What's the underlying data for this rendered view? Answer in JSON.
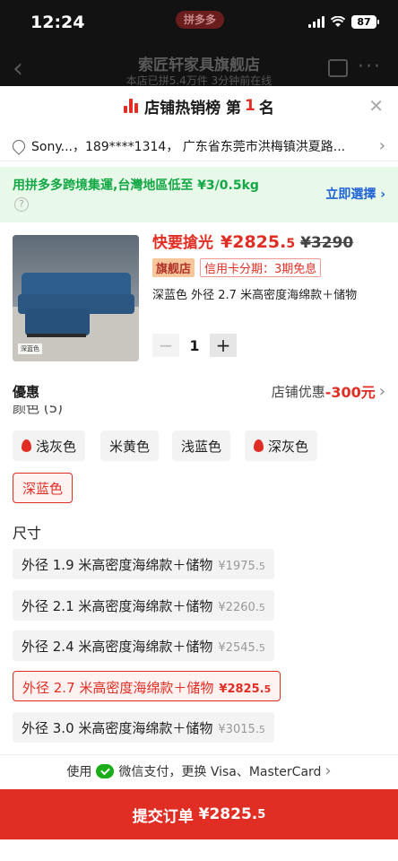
{
  "status": {
    "time": "12:24",
    "battery": "87",
    "app_badge": "拼多多"
  },
  "store": {
    "name": "索匠轩家具旗舰店",
    "subtitle": "本店已拼5.4万件  3分钟前在线"
  },
  "rank": {
    "prefix": "店铺热销榜 第",
    "number": "1",
    "suffix": "名"
  },
  "address": {
    "text": "Sony...，189****1314，  广东省东莞市洪梅镇洪夏路..."
  },
  "promo": {
    "text": "用拼多多跨境集運,台灣地區低至 ¥3/0.5kg",
    "button": "立即選擇"
  },
  "product": {
    "flash_label": "快要搶光",
    "price_main": "¥2825.",
    "price_dec": "5",
    "price_old": "¥3290",
    "tag_store": "旗舰店",
    "tag_credit": "信用卡分期：3期免息",
    "spec": "深蓝色 外径 2.7 米高密度海绵款＋储物",
    "image_label": "深蓝色",
    "quantity": "1",
    "minus": "−",
    "plus": "+"
  },
  "discount": {
    "label": "優惠",
    "text": "店铺优惠",
    "amount": "-300元"
  },
  "colors": {
    "heading": "颜色 (5)",
    "options": [
      {
        "label": "浅灰色",
        "hot": true,
        "selected": false
      },
      {
        "label": "米黄色",
        "hot": false,
        "selected": false
      },
      {
        "label": "浅蓝色",
        "hot": false,
        "selected": false
      },
      {
        "label": "深灰色",
        "hot": true,
        "selected": false
      },
      {
        "label": "深蓝色",
        "hot": false,
        "selected": true
      }
    ]
  },
  "sizes": {
    "heading": "尺寸",
    "options": [
      {
        "label": "外径 1.9 米高密度海绵款＋储物",
        "price": "¥1975.",
        "dec": "5",
        "selected": false
      },
      {
        "label": "外径 2.1 米高密度海绵款＋储物",
        "price": "¥2260.",
        "dec": "5",
        "selected": false
      },
      {
        "label": "外径 2.4 米高密度海绵款＋储物",
        "price": "¥2545.",
        "dec": "5",
        "selected": false
      },
      {
        "label": "外径 2.7 米高密度海绵款＋储物",
        "price": "¥2825.",
        "dec": "5",
        "selected": true
      },
      {
        "label": "外径 3.0 米高密度海绵款＋储物",
        "price": "¥3015.",
        "dec": "5",
        "selected": false
      }
    ]
  },
  "payment": {
    "prefix": "使用",
    "text": "微信支付，更换 Visa、MasterCard"
  },
  "submit": {
    "label": "提交订单",
    "price": "¥2825.",
    "dec": "5"
  },
  "colors_theme": {
    "accent": "#e02e24",
    "promo_green": "#13a845",
    "link_blue": "#1f62d6"
  }
}
